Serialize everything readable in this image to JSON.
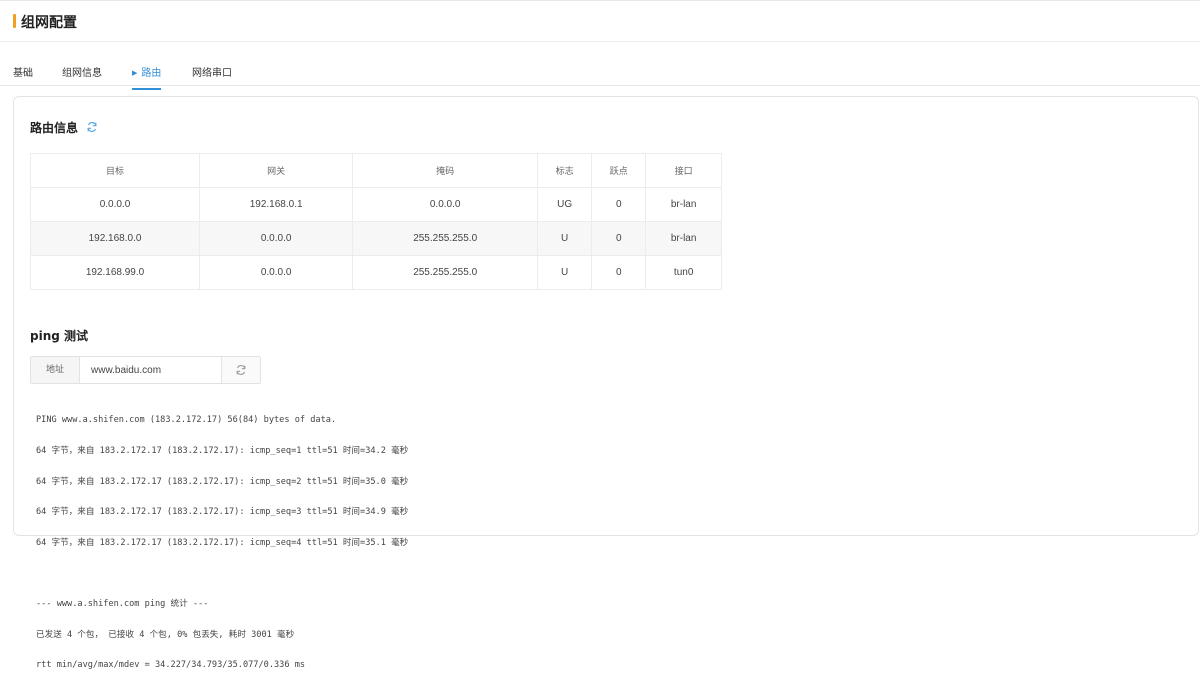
{
  "header": {
    "title": "组网配置",
    "accent_color": "#f0a020"
  },
  "tabs": [
    {
      "label": "基础",
      "active": false
    },
    {
      "label": "组网信息",
      "active": false
    },
    {
      "label": "路由",
      "active": true
    },
    {
      "label": "网络串口",
      "active": false
    }
  ],
  "route": {
    "title": "路由信息",
    "refresh_icon": "refresh-icon",
    "columns": [
      "目标",
      "网关",
      "掩码",
      "标志",
      "跃点",
      "接口"
    ],
    "rows": [
      [
        "0.0.0.0",
        "192.168.0.1",
        "0.0.0.0",
        "UG",
        "0",
        "br-lan"
      ],
      [
        "192.168.0.0",
        "0.0.0.0",
        "255.255.255.0",
        "U",
        "0",
        "br-lan"
      ],
      [
        "192.168.99.0",
        "0.0.0.0",
        "255.255.255.0",
        "U",
        "0",
        "tun0"
      ]
    ]
  },
  "ping": {
    "title": "ping 测试",
    "address_label": "地址",
    "address_value": "www.baidu.com",
    "run_icon": "refresh-icon",
    "output": [
      "PING www.a.shifen.com (183.2.172.17) 56(84) bytes of data.",
      "64 字节，来自 183.2.172.17 (183.2.172.17): icmp_seq=1 ttl=51 时间=34.2 毫秒",
      "64 字节，来自 183.2.172.17 (183.2.172.17): icmp_seq=2 ttl=51 时间=35.0 毫秒",
      "64 字节，来自 183.2.172.17 (183.2.172.17): icmp_seq=3 ttl=51 时间=34.9 毫秒",
      "64 字节，来自 183.2.172.17 (183.2.172.17): icmp_seq=4 ttl=51 时间=35.1 毫秒",
      "",
      "--- www.a.shifen.com ping 统计 ---",
      "已发送 4 个包， 已接收 4 个包, 0% 包丢失, 耗时 3001 毫秒",
      "rtt min/avg/max/mdev = 34.227/34.793/35.077/0.336 ms"
    ]
  },
  "colors": {
    "active_tab": "#2f8fd8",
    "border": "#e4e4e4"
  }
}
